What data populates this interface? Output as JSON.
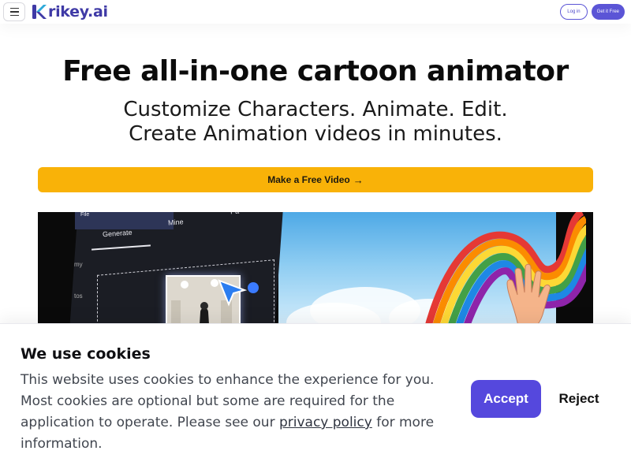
{
  "header": {
    "logo_text": "rikey.ai",
    "login_label": "Log in",
    "get_it_label": "Get it Free"
  },
  "hero": {
    "title": "Free all-in-one cartoon animator",
    "subtitle_line1": "Customize Characters. Animate. Edit.",
    "subtitle_line2": "Create Animation videos in minutes.",
    "cta_label": "Make a Free Video",
    "cta_icon": "arrow-right-icon"
  },
  "video": {
    "menu_file": "File",
    "tab_generate": "Generate",
    "tab_mine": "Mine",
    "tab_partial": "Pa",
    "side_label_1": "my",
    "side_label_2": "tos"
  },
  "cookie": {
    "title": "We use cookies",
    "text_before_link": "This website uses cookies to enhance the experience for you. Most cookies are optional but some are required for the application to operate. Please see our ",
    "link_text": "privacy policy",
    "text_after_link": " for more information.",
    "accept_label": "Accept",
    "reject_label": "Reject"
  },
  "colors": {
    "brand": "#3f3aa6",
    "primary_button": "#5548dd",
    "cta_yellow": "#f9b208"
  }
}
